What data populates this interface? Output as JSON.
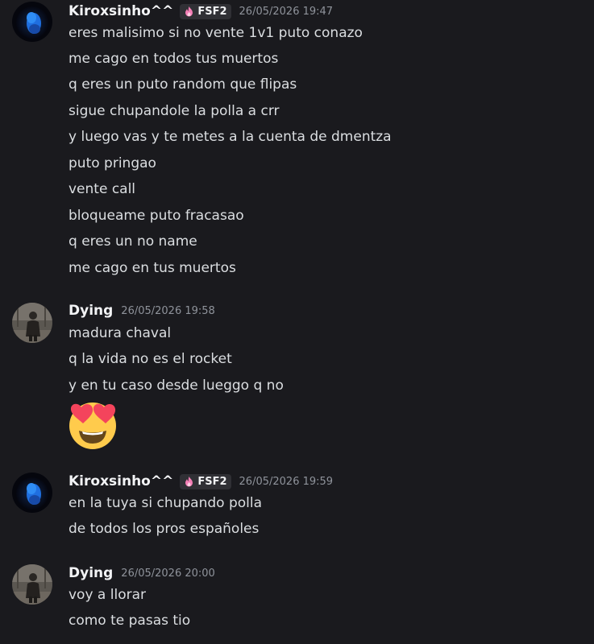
{
  "colors": {
    "background": "#1a1a1e",
    "username": "#f2f3f5",
    "text": "#dbdee1",
    "timestamp": "#8f939b",
    "tag_bg": "#303035",
    "tag_icon": "#f47fb6"
  },
  "messages": [
    {
      "username": "Kiroxsinho^^",
      "tag_icon": "flame-icon",
      "tag": "FSF2",
      "timestamp": "26/05/2026 19:47",
      "avatar": "blue-glow-avatar",
      "lines": [
        "eres malisimo si no vente 1v1 puto conazo",
        "me cago en todos tus muertos",
        "q eres un puto random que flipas",
        "sigue chupandole la polla a crr",
        "y luego vas y te metes a la cuenta de dmentza",
        "puto pringao",
        "vente call",
        "bloqueame puto fracasao",
        "q eres un no name",
        "me cago en tus muertos"
      ]
    },
    {
      "username": "Dying",
      "timestamp": "26/05/2026 19:58",
      "avatar": "person-photo-avatar",
      "lines": [
        "madura chaval",
        "q la vida no es el rocket",
        "y en tu caso desde lueggo q no"
      ],
      "emoji": "heart-eyes-emoji"
    },
    {
      "username": "Kiroxsinho^^",
      "tag_icon": "flame-icon",
      "tag": "FSF2",
      "timestamp": "26/05/2026 19:59",
      "avatar": "blue-glow-avatar",
      "lines": [
        "en la tuya si chupando polla",
        "de todos los pros españoles"
      ]
    },
    {
      "username": "Dying",
      "timestamp": "26/05/2026 20:00",
      "avatar": "person-photo-avatar",
      "lines": [
        "voy a llorar",
        "como te pasas tio"
      ]
    }
  ]
}
